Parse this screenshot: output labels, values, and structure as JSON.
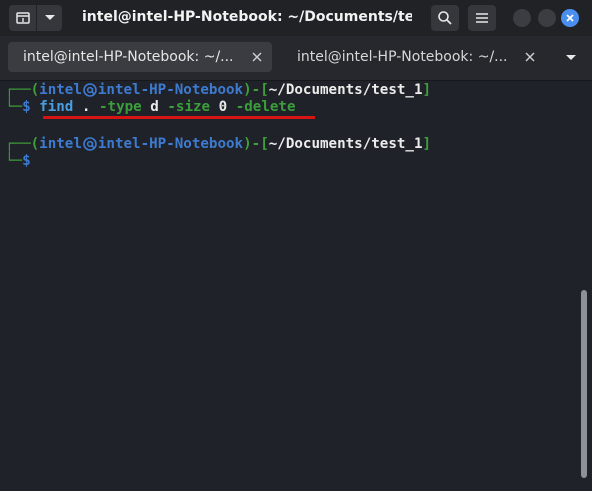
{
  "window": {
    "title": "intel@intel-HP-Notebook: ~/Documents/test..."
  },
  "header": {
    "new_tab_icon": "new-tab-icon",
    "dropdown_icon": "chevron-down-icon",
    "search_icon": "search-icon",
    "menu_icon": "hamburger-menu-icon",
    "close_icon": "close-icon"
  },
  "tabs": [
    {
      "label": "intel@intel-HP-Notebook: ~/...",
      "active": true
    },
    {
      "label": "intel@intel-HP-Notebook: ~/...",
      "active": false
    }
  ],
  "terminal": {
    "prompts": [
      {
        "open": "┌──(",
        "user": "intel",
        "host": "intel-HP-Notebook",
        "sep": ")-[",
        "path": "~/Documents/test_1",
        "close": "]",
        "prefix": "└─",
        "dollar": "$",
        "command": {
          "cmd": "find",
          "target": ".",
          "flag1": "-type",
          "val1": "d",
          "flag2": "-size",
          "val2": "0",
          "flag3": "-delete"
        }
      },
      {
        "open": "┌──(",
        "user": "intel",
        "host": "intel-HP-Notebook",
        "sep": ")-[",
        "path": "~/Documents/test_1",
        "close": "]",
        "prefix": "└─",
        "dollar": "$"
      }
    ]
  },
  "colors": {
    "accent_close": "#4a8ef0",
    "highlight_underline": "#d61414",
    "prompt_frame": "#3f9f3a",
    "prompt_user": "#3e7bd0"
  }
}
